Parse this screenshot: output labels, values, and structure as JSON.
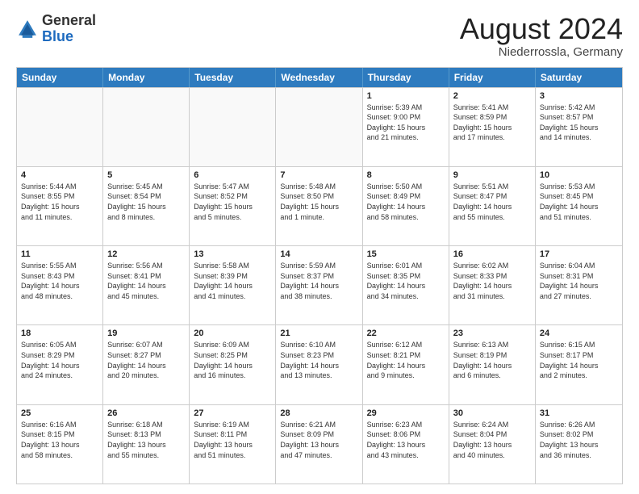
{
  "logo": {
    "general": "General",
    "blue": "Blue"
  },
  "title": "August 2024",
  "subtitle": "Niederrossla, Germany",
  "header_days": [
    "Sunday",
    "Monday",
    "Tuesday",
    "Wednesday",
    "Thursday",
    "Friday",
    "Saturday"
  ],
  "rows": [
    [
      {
        "day": "",
        "info": "",
        "empty": true
      },
      {
        "day": "",
        "info": "",
        "empty": true
      },
      {
        "day": "",
        "info": "",
        "empty": true
      },
      {
        "day": "",
        "info": "",
        "empty": true
      },
      {
        "day": "1",
        "info": "Sunrise: 5:39 AM\nSunset: 9:00 PM\nDaylight: 15 hours\nand 21 minutes.",
        "empty": false
      },
      {
        "day": "2",
        "info": "Sunrise: 5:41 AM\nSunset: 8:59 PM\nDaylight: 15 hours\nand 17 minutes.",
        "empty": false
      },
      {
        "day": "3",
        "info": "Sunrise: 5:42 AM\nSunset: 8:57 PM\nDaylight: 15 hours\nand 14 minutes.",
        "empty": false
      }
    ],
    [
      {
        "day": "4",
        "info": "Sunrise: 5:44 AM\nSunset: 8:55 PM\nDaylight: 15 hours\nand 11 minutes.",
        "empty": false
      },
      {
        "day": "5",
        "info": "Sunrise: 5:45 AM\nSunset: 8:54 PM\nDaylight: 15 hours\nand 8 minutes.",
        "empty": false
      },
      {
        "day": "6",
        "info": "Sunrise: 5:47 AM\nSunset: 8:52 PM\nDaylight: 15 hours\nand 5 minutes.",
        "empty": false
      },
      {
        "day": "7",
        "info": "Sunrise: 5:48 AM\nSunset: 8:50 PM\nDaylight: 15 hours\nand 1 minute.",
        "empty": false
      },
      {
        "day": "8",
        "info": "Sunrise: 5:50 AM\nSunset: 8:49 PM\nDaylight: 14 hours\nand 58 minutes.",
        "empty": false
      },
      {
        "day": "9",
        "info": "Sunrise: 5:51 AM\nSunset: 8:47 PM\nDaylight: 14 hours\nand 55 minutes.",
        "empty": false
      },
      {
        "day": "10",
        "info": "Sunrise: 5:53 AM\nSunset: 8:45 PM\nDaylight: 14 hours\nand 51 minutes.",
        "empty": false
      }
    ],
    [
      {
        "day": "11",
        "info": "Sunrise: 5:55 AM\nSunset: 8:43 PM\nDaylight: 14 hours\nand 48 minutes.",
        "empty": false
      },
      {
        "day": "12",
        "info": "Sunrise: 5:56 AM\nSunset: 8:41 PM\nDaylight: 14 hours\nand 45 minutes.",
        "empty": false
      },
      {
        "day": "13",
        "info": "Sunrise: 5:58 AM\nSunset: 8:39 PM\nDaylight: 14 hours\nand 41 minutes.",
        "empty": false
      },
      {
        "day": "14",
        "info": "Sunrise: 5:59 AM\nSunset: 8:37 PM\nDaylight: 14 hours\nand 38 minutes.",
        "empty": false
      },
      {
        "day": "15",
        "info": "Sunrise: 6:01 AM\nSunset: 8:35 PM\nDaylight: 14 hours\nand 34 minutes.",
        "empty": false
      },
      {
        "day": "16",
        "info": "Sunrise: 6:02 AM\nSunset: 8:33 PM\nDaylight: 14 hours\nand 31 minutes.",
        "empty": false
      },
      {
        "day": "17",
        "info": "Sunrise: 6:04 AM\nSunset: 8:31 PM\nDaylight: 14 hours\nand 27 minutes.",
        "empty": false
      }
    ],
    [
      {
        "day": "18",
        "info": "Sunrise: 6:05 AM\nSunset: 8:29 PM\nDaylight: 14 hours\nand 24 minutes.",
        "empty": false
      },
      {
        "day": "19",
        "info": "Sunrise: 6:07 AM\nSunset: 8:27 PM\nDaylight: 14 hours\nand 20 minutes.",
        "empty": false
      },
      {
        "day": "20",
        "info": "Sunrise: 6:09 AM\nSunset: 8:25 PM\nDaylight: 14 hours\nand 16 minutes.",
        "empty": false
      },
      {
        "day": "21",
        "info": "Sunrise: 6:10 AM\nSunset: 8:23 PM\nDaylight: 14 hours\nand 13 minutes.",
        "empty": false
      },
      {
        "day": "22",
        "info": "Sunrise: 6:12 AM\nSunset: 8:21 PM\nDaylight: 14 hours\nand 9 minutes.",
        "empty": false
      },
      {
        "day": "23",
        "info": "Sunrise: 6:13 AM\nSunset: 8:19 PM\nDaylight: 14 hours\nand 6 minutes.",
        "empty": false
      },
      {
        "day": "24",
        "info": "Sunrise: 6:15 AM\nSunset: 8:17 PM\nDaylight: 14 hours\nand 2 minutes.",
        "empty": false
      }
    ],
    [
      {
        "day": "25",
        "info": "Sunrise: 6:16 AM\nSunset: 8:15 PM\nDaylight: 13 hours\nand 58 minutes.",
        "empty": false
      },
      {
        "day": "26",
        "info": "Sunrise: 6:18 AM\nSunset: 8:13 PM\nDaylight: 13 hours\nand 55 minutes.",
        "empty": false
      },
      {
        "day": "27",
        "info": "Sunrise: 6:19 AM\nSunset: 8:11 PM\nDaylight: 13 hours\nand 51 minutes.",
        "empty": false
      },
      {
        "day": "28",
        "info": "Sunrise: 6:21 AM\nSunset: 8:09 PM\nDaylight: 13 hours\nand 47 minutes.",
        "empty": false
      },
      {
        "day": "29",
        "info": "Sunrise: 6:23 AM\nSunset: 8:06 PM\nDaylight: 13 hours\nand 43 minutes.",
        "empty": false
      },
      {
        "day": "30",
        "info": "Sunrise: 6:24 AM\nSunset: 8:04 PM\nDaylight: 13 hours\nand 40 minutes.",
        "empty": false
      },
      {
        "day": "31",
        "info": "Sunrise: 6:26 AM\nSunset: 8:02 PM\nDaylight: 13 hours\nand 36 minutes.",
        "empty": false
      }
    ]
  ]
}
